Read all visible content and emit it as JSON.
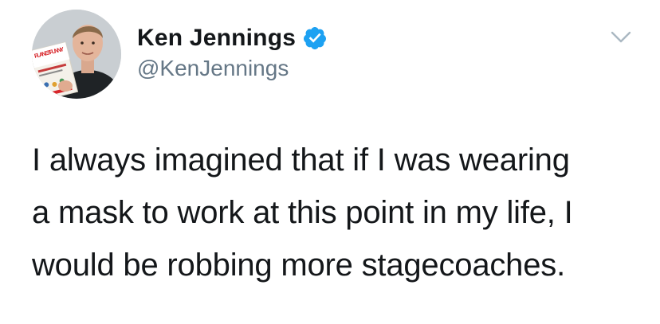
{
  "author": {
    "display_name": "Ken Jennings",
    "handle": "@KenJennings",
    "verified": true,
    "avatar_icon": "profile-photo-holding-book",
    "avatar_book_text": "PLANET FUNNY"
  },
  "tweet": {
    "text": "I always imagined that if I was wearing\na mask to work at this point in my life, I\nwould be robbing more stagecoaches."
  },
  "menu": {
    "icon": "chevron-down-icon"
  },
  "colors": {
    "text_primary": "#14171a",
    "text_secondary": "#657786",
    "verified_blue": "#1da1f2",
    "caret_gray": "#aab8c2"
  }
}
